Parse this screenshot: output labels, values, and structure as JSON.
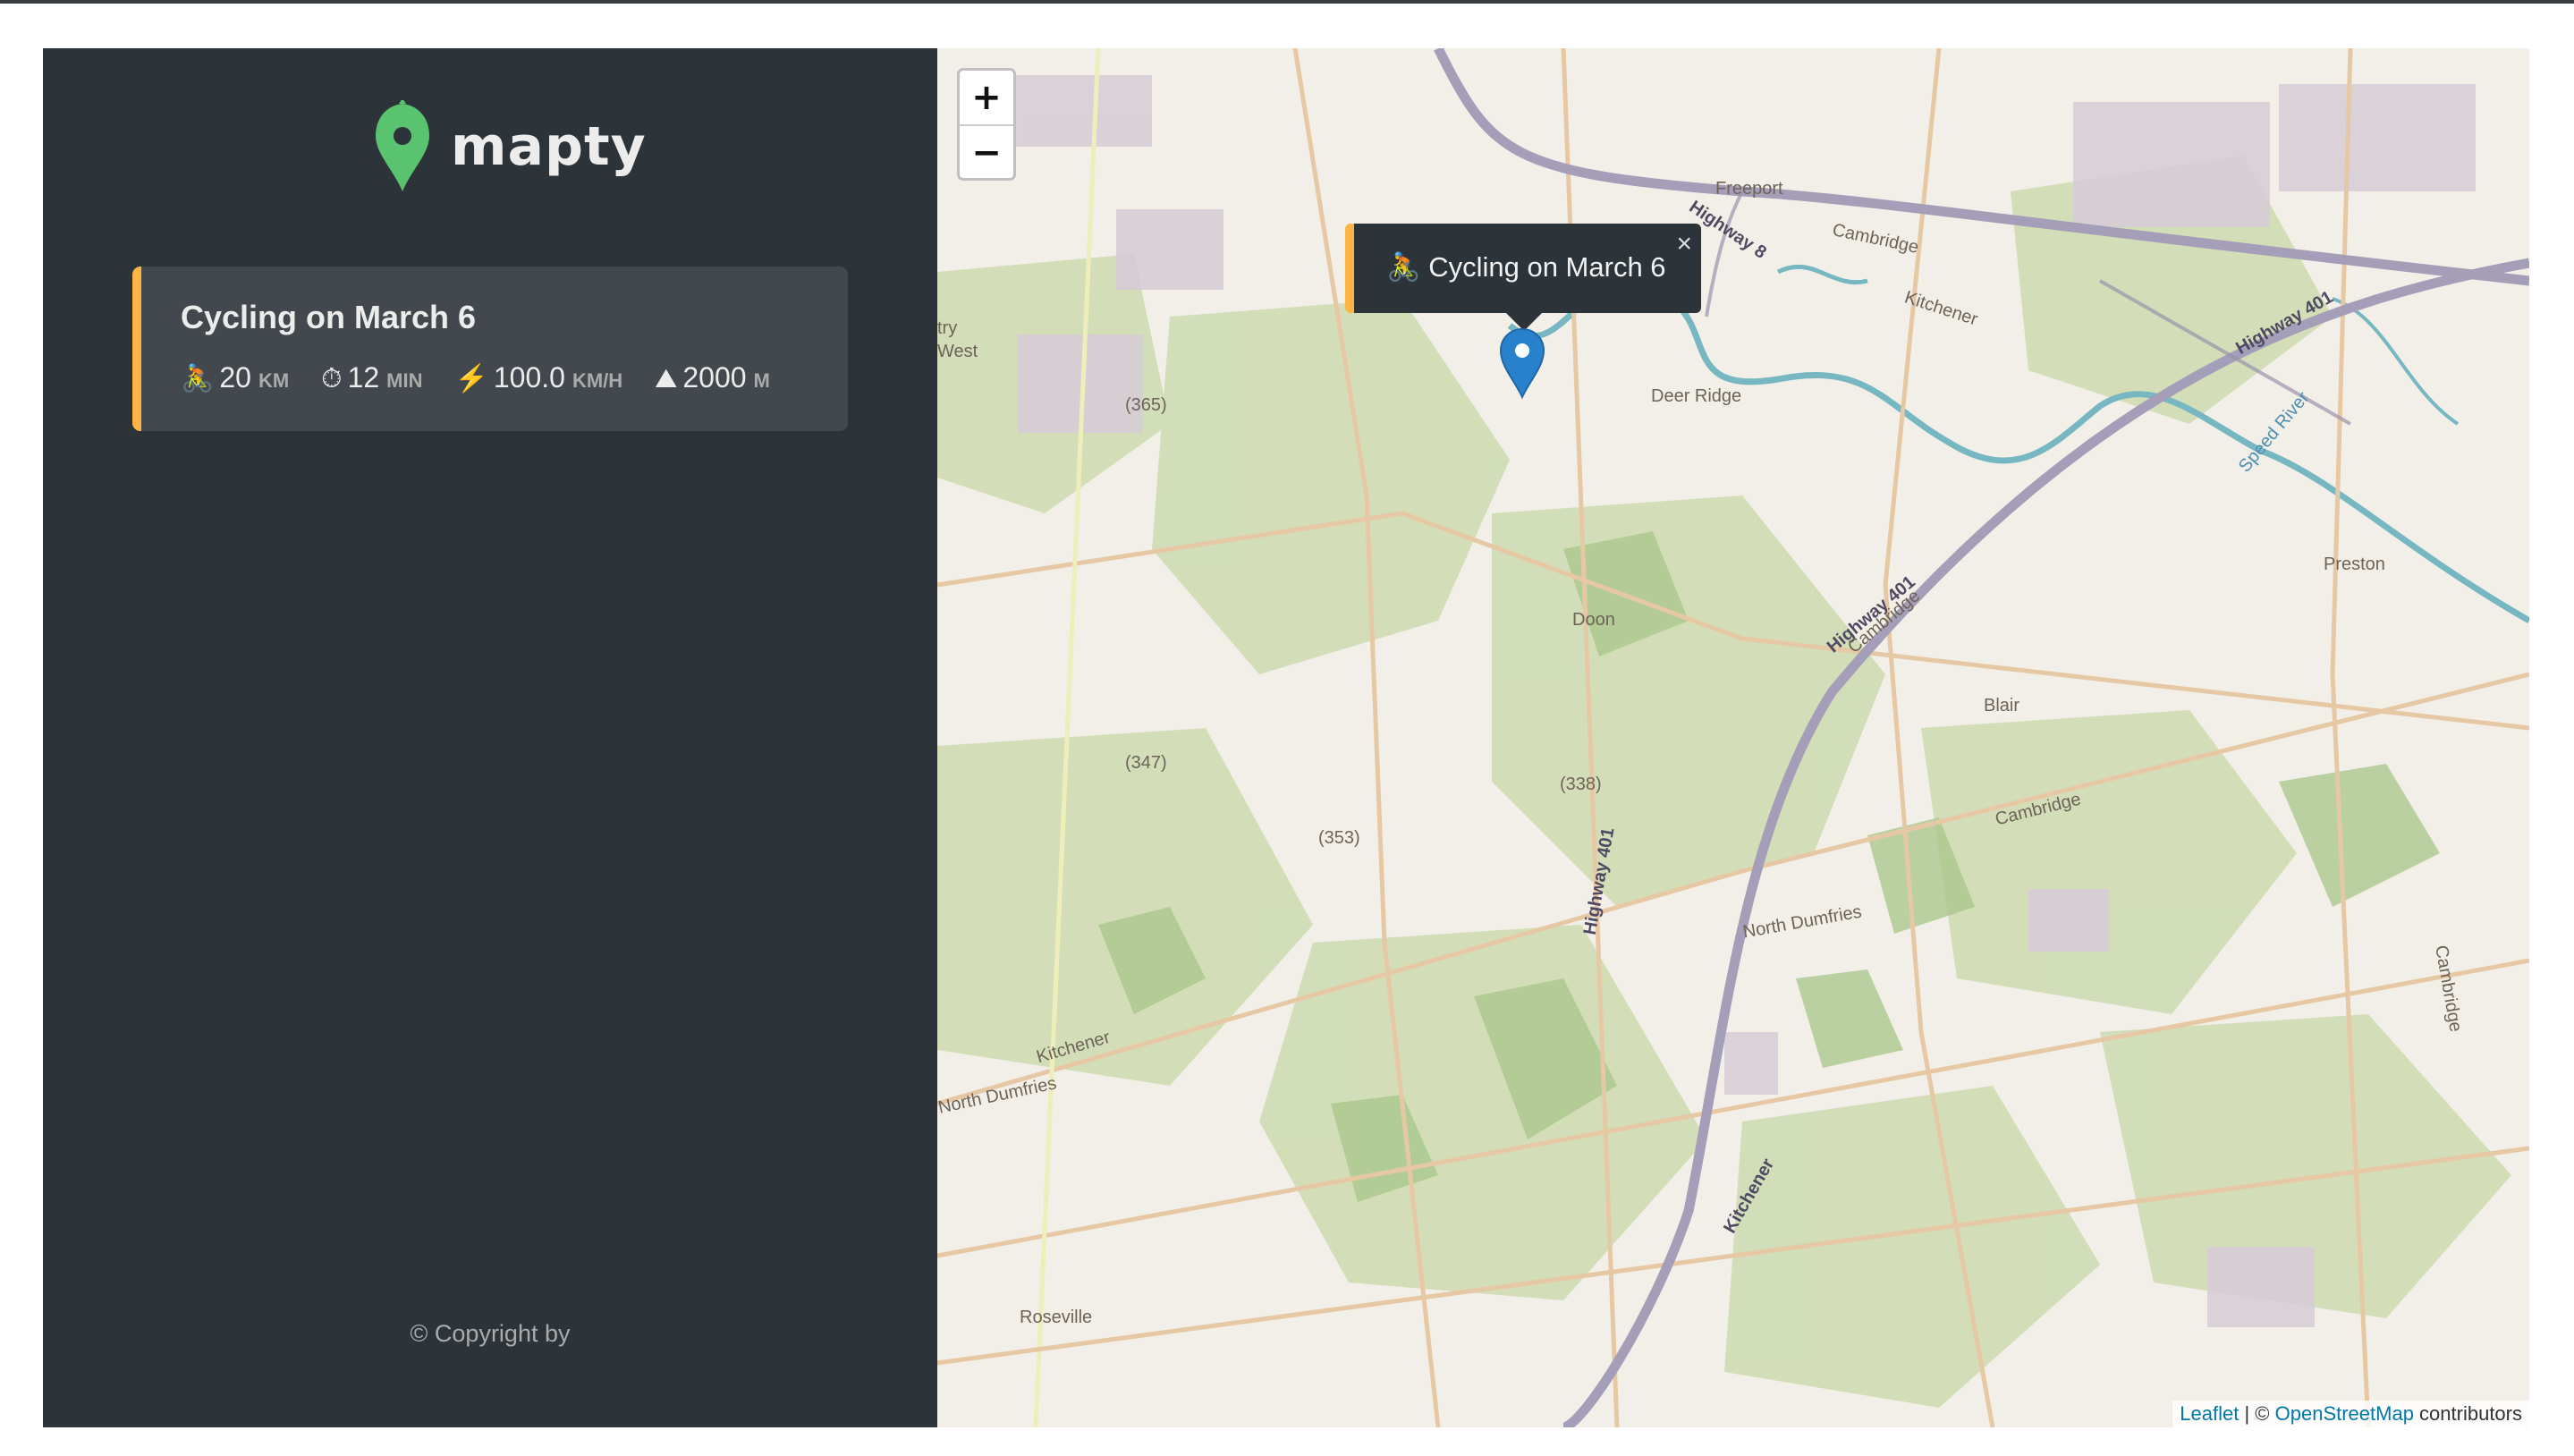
{
  "app": {
    "name": "mapty",
    "copyright": "© Copyright by"
  },
  "workout": {
    "title": "Cycling on March 6",
    "accent": "#ffb545",
    "details": [
      {
        "icon": "cyclist-icon",
        "glyph": "🚴",
        "value": "20",
        "unit": "km"
      },
      {
        "icon": "stopwatch-icon",
        "glyph": "⏱",
        "value": "12",
        "unit": "min"
      },
      {
        "icon": "lightning-icon",
        "glyph": "⚡",
        "value": "100.0",
        "unit": "km/h"
      },
      {
        "icon": "mountain-icon",
        "glyph": "⛰",
        "value": "2000",
        "unit": "m"
      }
    ]
  },
  "map": {
    "zoom_in": "+",
    "zoom_out": "−",
    "popup": {
      "text": "🚴 Cycling on March 6",
      "close": "×"
    },
    "attribution": {
      "leaflet": "Leaflet",
      "separator": " | © ",
      "osm": "OpenStreetMap",
      "suffix": " contributors"
    },
    "place_labels": [
      "Freeport",
      "Cambridge",
      "Kitchener",
      "Highway 8",
      "Highway 401",
      "Deer Ridge",
      "Doon",
      "Preston",
      "Blair",
      "Cambridge",
      "North Dumfries",
      "Kitchener",
      "North Dumfries",
      "Roseville",
      "Highway 401",
      "Highway 401",
      "(365)",
      "(347)",
      "(353)",
      "(338)",
      "Speed River",
      "Cambridge",
      "Cambridge",
      "Kitchener",
      "try",
      "West"
    ]
  },
  "colors": {
    "sidebar": "#2d3439",
    "card": "#42484d",
    "brand_green": "#00c46a",
    "accent": "#ffb545"
  }
}
